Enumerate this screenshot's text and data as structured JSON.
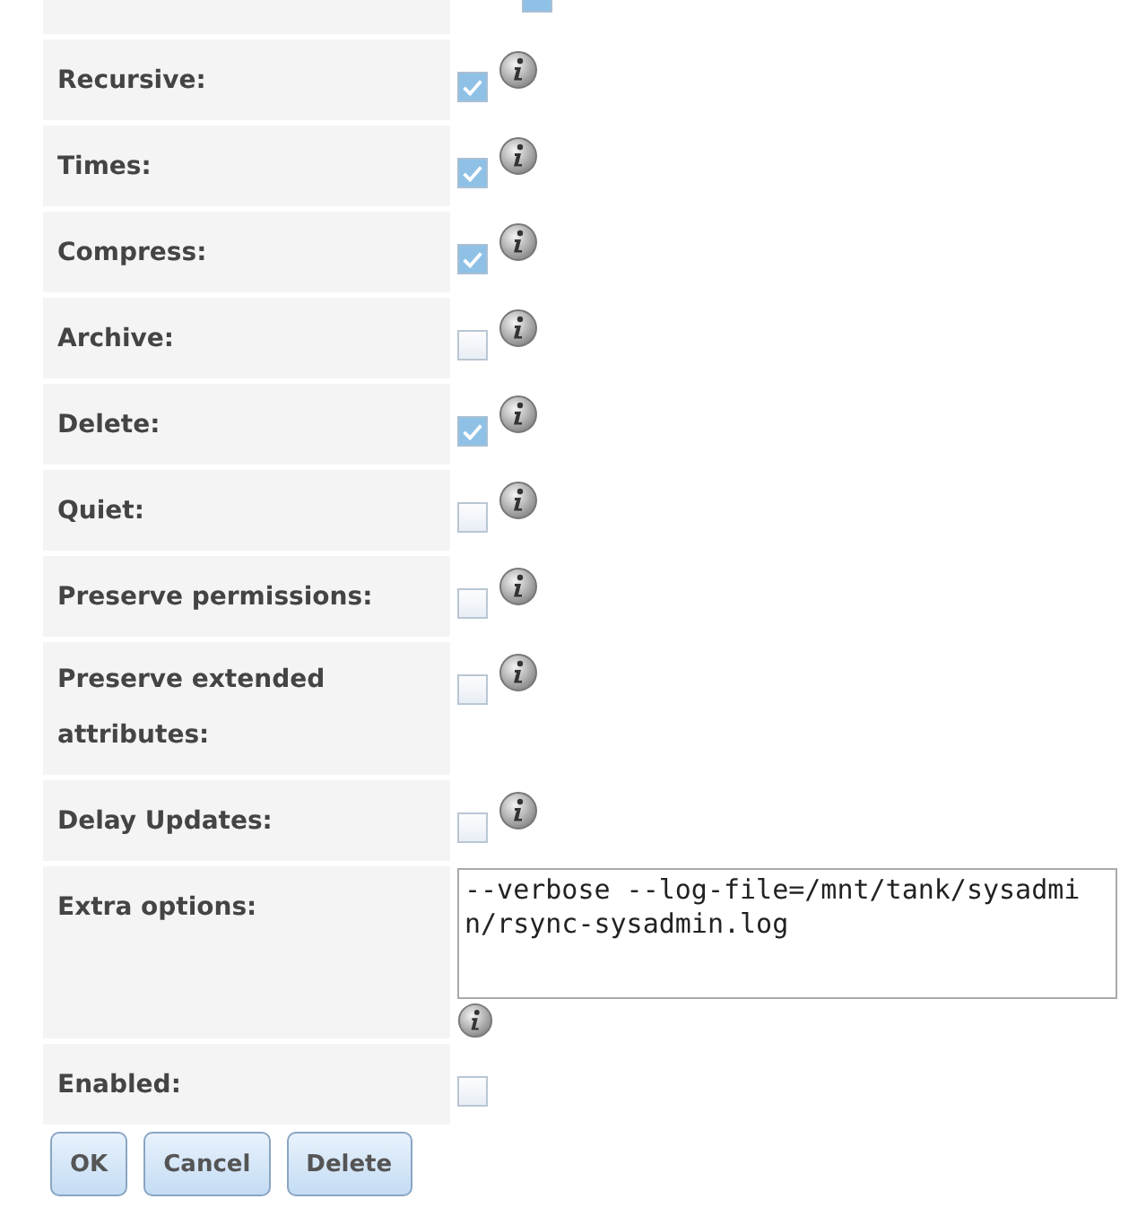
{
  "top_row": {
    "checked": true
  },
  "options": [
    {
      "kind": "checkbox",
      "label": "Recursive:",
      "checked": true
    },
    {
      "kind": "checkbox",
      "label": "Times:",
      "checked": true
    },
    {
      "kind": "checkbox",
      "label": "Compress:",
      "checked": true
    },
    {
      "kind": "checkbox",
      "label": "Archive:",
      "checked": false
    },
    {
      "kind": "checkbox",
      "label": "Delete:",
      "checked": true
    },
    {
      "kind": "checkbox",
      "label": "Quiet:",
      "checked": false
    },
    {
      "kind": "checkbox",
      "label": "Preserve permissions:",
      "checked": false
    },
    {
      "kind": "checkbox",
      "label": "Preserve extended attributes:",
      "checked": false
    },
    {
      "kind": "checkbox",
      "label": "Delay Updates:",
      "checked": false
    },
    {
      "kind": "textarea",
      "label": "Extra options:",
      "value": "--verbose --log-file=/mnt/tank/sysadmin/rsync-sysadmin.log"
    },
    {
      "kind": "plain_checkbox",
      "label": "Enabled:",
      "checked": false
    }
  ],
  "buttons": [
    "OK",
    "Cancel",
    "Delete"
  ]
}
